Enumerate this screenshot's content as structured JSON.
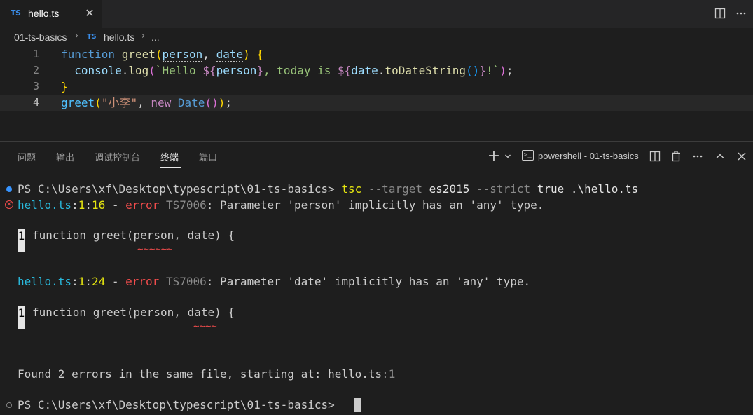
{
  "tabbar": {
    "tab": {
      "lang_badge": "TS",
      "file_name": "hello.ts",
      "close_glyph": "✕"
    },
    "right_icons": [
      "split-editor-icon",
      "more-actions-icon"
    ]
  },
  "breadcrumb": {
    "folder": "01-ts-basics",
    "file_badge": "TS",
    "file": "hello.ts",
    "ellipsis": "..."
  },
  "editor": {
    "line_numbers": [
      "1",
      "2",
      "3",
      "4"
    ],
    "tokens": {
      "l1_function": "function",
      "l1_greet": "greet",
      "l1_open": "(",
      "l1_person": "person",
      "l1_comma": ", ",
      "l1_date": "date",
      "l1_close": ")",
      "l1_brace": " {",
      "l2_indent": "  ",
      "l2_console": "console",
      "l2_dot": ".",
      "l2_log": "log",
      "l2_open": "(",
      "l2_tpl1": "`Hello ",
      "l2_d1": "${",
      "l2_person": "person",
      "l2_c1": "}",
      "l2_tpl2": ", today is ",
      "l2_d2": "${",
      "l2_date": "date",
      "l2_dot2": ".",
      "l2_toDate": "toDateString",
      "l2_paren": "()",
      "l2_c2": "}",
      "l2_tpl3": "!`",
      "l2_close": ")",
      "l2_semi": ";",
      "l3_brace": "}",
      "l4_greet": "greet",
      "l4_open": "(",
      "l4_str": "\"小李\"",
      "l4_comma": ", ",
      "l4_new": "new",
      "l4_sp": " ",
      "l4_Date": "Date",
      "l4_paren": "()",
      "l4_close": ")",
      "l4_semi": ";"
    }
  },
  "panel": {
    "tabs": [
      "问题",
      "输出",
      "调试控制台",
      "终端",
      "端口"
    ],
    "active_tab": "终端",
    "terminal_name": "powershell - 01-ts-basics",
    "controls": [
      "add-terminal-icon",
      "chevron-down-icon",
      "split-terminal-icon",
      "trash-icon",
      "more-actions-icon",
      "maximize-panel-icon",
      "close-panel-icon"
    ]
  },
  "terminal": {
    "prompt1": "PS C:\\Users\\xf\\Desktop\\typescript\\01-ts-basics> ",
    "cmd_tsc": "tsc",
    "opt_target": " --target ",
    "val_target": "es2015",
    "opt_strict": " --strict ",
    "val_strict": "true .\\hello.ts",
    "err1": {
      "file": "hello.ts",
      "colon1": ":",
      "line": "1",
      "colon2": ":",
      "col": "16",
      "dash": " - ",
      "word": "error",
      "code": " TS7006",
      "msg": ": Parameter 'person' implicitly has an 'any' type."
    },
    "snippet1": {
      "gutter": "1",
      "code": "function greet(person, date) {",
      "squiggle": "~~~~~~"
    },
    "err2": {
      "file": "hello.ts",
      "colon1": ":",
      "line": "1",
      "colon2": ":",
      "col": "24",
      "dash": " - ",
      "word": "error",
      "code": " TS7006",
      "msg": ": Parameter 'date' implicitly has an 'any' type."
    },
    "snippet2": {
      "gutter": "1",
      "code": "function greet(person, date) {",
      "squiggle": "~~~~"
    },
    "summary": "Found 2 errors in the same file, starting at: hello.ts",
    "summary_suffix": ":1",
    "prompt2": "PS C:\\Users\\xf\\Desktop\\typescript\\01-ts-basics> "
  }
}
